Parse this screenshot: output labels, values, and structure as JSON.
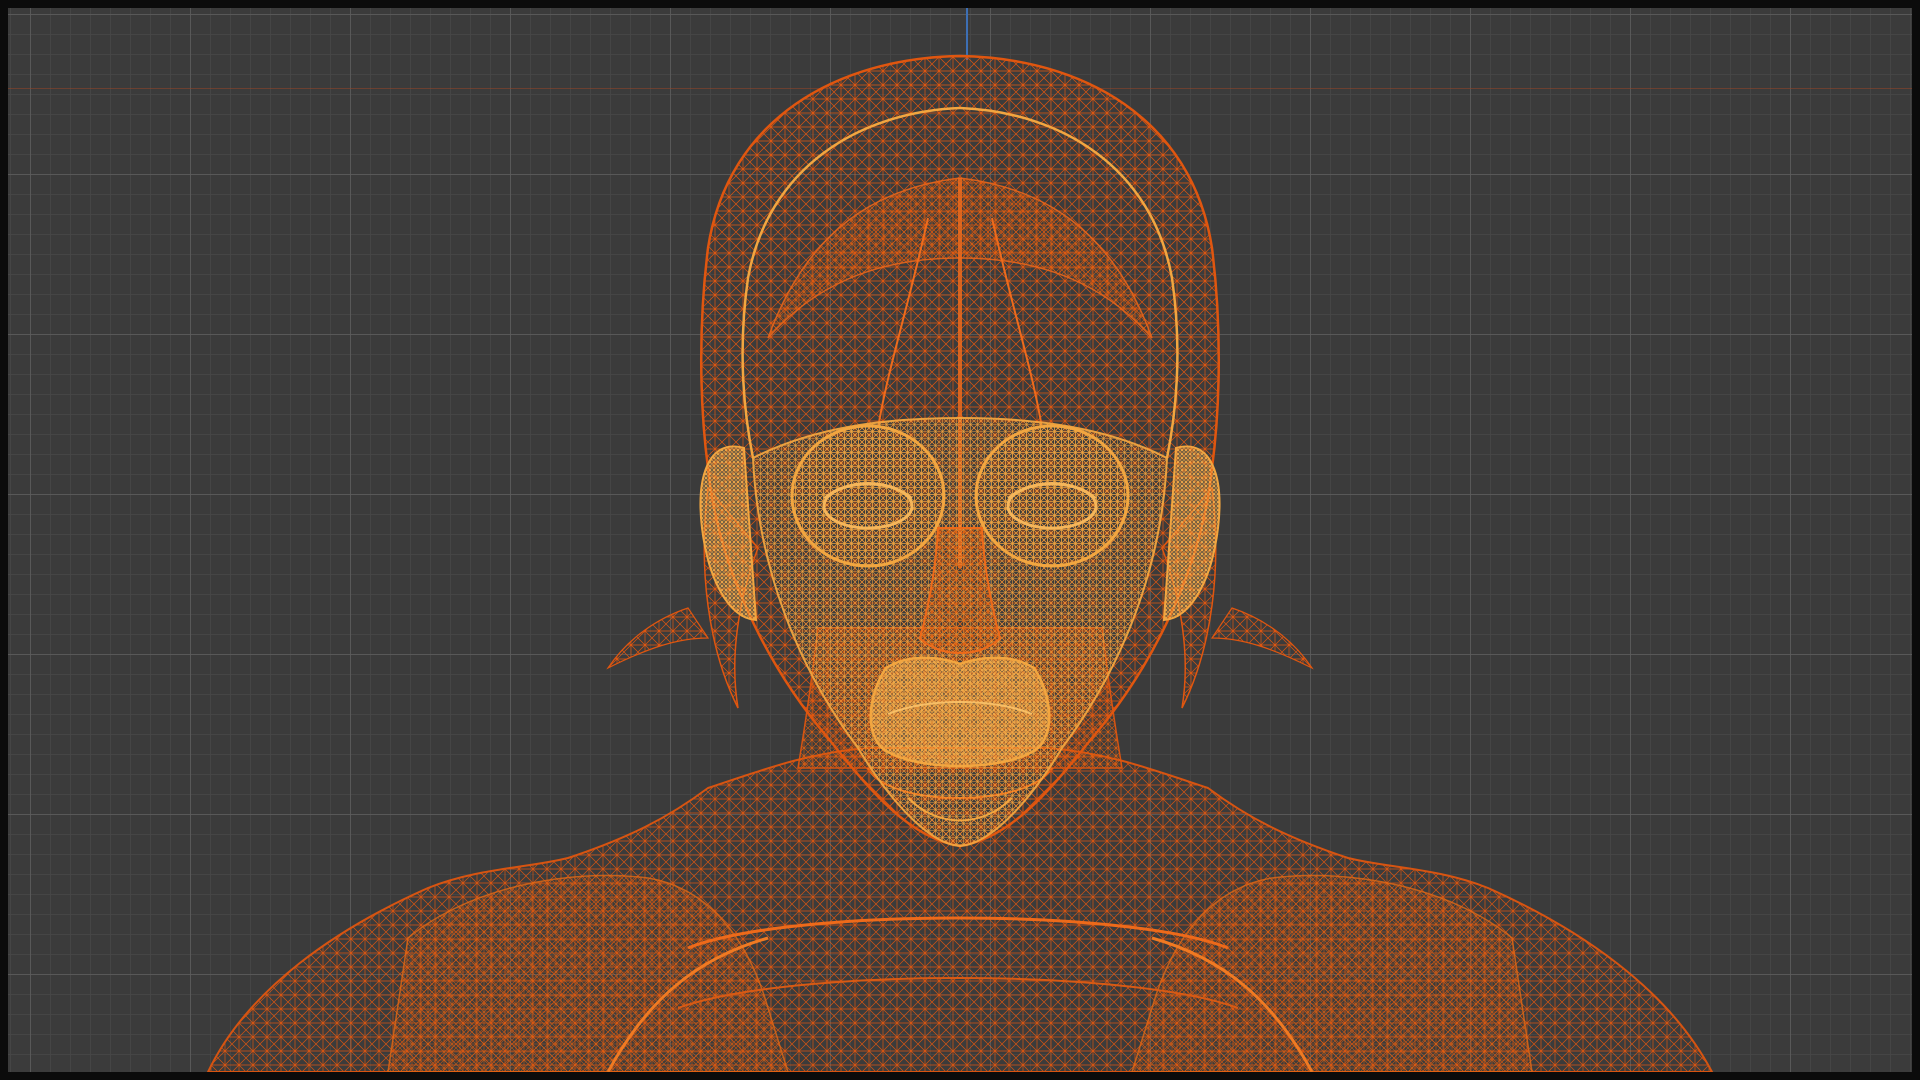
{
  "viewport": {
    "mode": "wireframe",
    "background_color": "#3b3b3b",
    "grid_color": "#5c5c5c",
    "axis_z_color": "#3d6fb4",
    "axis_x_color": "#96462a"
  },
  "mesh": {
    "object": "character-bust",
    "wire_color": "#e8560f",
    "selected_wire_color": "#f2a640"
  }
}
